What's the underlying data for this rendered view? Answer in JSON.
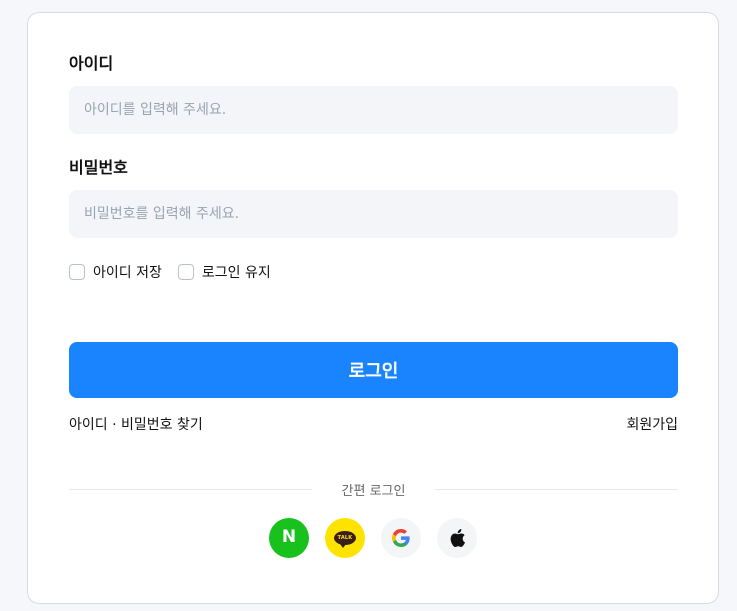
{
  "login_form": {
    "id_label": "아이디",
    "id_placeholder": "아이디를 입력해 주세요.",
    "password_label": "비밀번호",
    "password_placeholder": "비밀번호를 입력해 주세요.",
    "remember_id_label": "아이디 저장",
    "keep_login_label": "로그인 유지",
    "login_button": "로그인"
  },
  "links": {
    "find_account": "아이디 · 비밀번호 찾기",
    "signup": "회원가입"
  },
  "simple_login": {
    "divider_text": "간편 로그인",
    "providers": [
      {
        "name": "naver",
        "icon": "naver-icon",
        "glyph": "N",
        "color": "#19c11d"
      },
      {
        "name": "kakao",
        "icon": "kakao-icon",
        "glyph": "TALK",
        "color": "#ffe300"
      },
      {
        "name": "google",
        "icon": "google-icon",
        "color": "#f4f5f7"
      },
      {
        "name": "apple",
        "icon": "apple-icon",
        "color": "#f4f5f7"
      }
    ]
  },
  "colors": {
    "primary": "#1a84ff",
    "input_bg": "#f3f5f9",
    "card_border": "#d7dbe6"
  }
}
